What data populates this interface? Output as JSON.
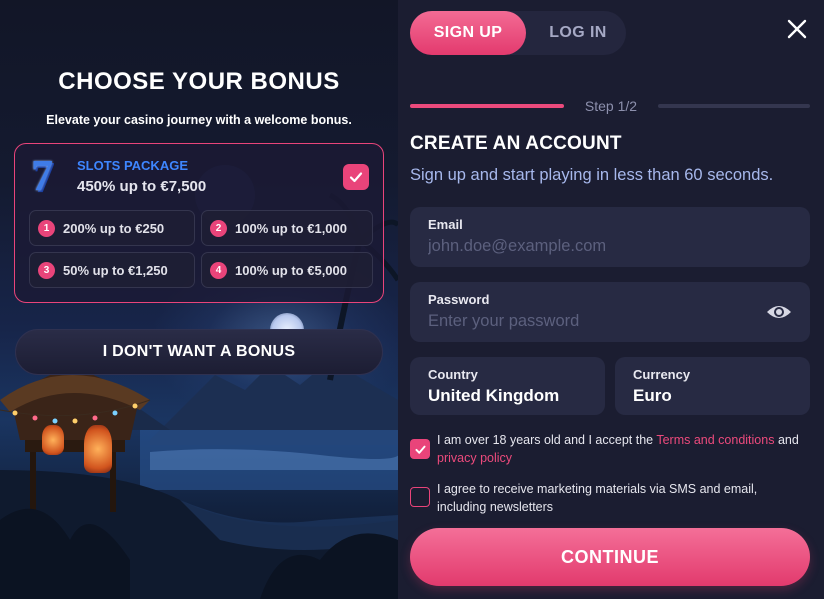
{
  "bonus": {
    "title": "CHOOSE YOUR BONUS",
    "subtitle": "Elevate your casino journey with a welcome bonus.",
    "package": {
      "icon": "lucky-seven-icon",
      "name": "SLOTS PACKAGE",
      "amount": "450% up to €7,500",
      "selected": true
    },
    "tiers": [
      {
        "num": "1",
        "label": "200% up to €250"
      },
      {
        "num": "2",
        "label": "100% up to €1,000"
      },
      {
        "num": "3",
        "label": "50% up to €1,250"
      },
      {
        "num": "4",
        "label": "100% up to €5,000"
      }
    ],
    "no_bonus_label": "I DON'T WANT A BONUS"
  },
  "auth": {
    "tabs": [
      {
        "label": "SIGN UP",
        "active": true
      },
      {
        "label": "LOG IN",
        "active": false
      }
    ],
    "step_label": "Step 1/2",
    "step_progress": 0.5,
    "heading": "CREATE AN ACCOUNT",
    "lead": "Sign up and start playing in less than 60 seconds.",
    "email": {
      "label": "Email",
      "value": "",
      "placeholder": "john.doe@example.com"
    },
    "password": {
      "label": "Password",
      "value": "",
      "placeholder": "Enter your password"
    },
    "country": {
      "label": "Country",
      "value": "United Kingdom"
    },
    "currency": {
      "label": "Currency",
      "value": "Euro"
    },
    "consent_age": {
      "checked": true,
      "text_before": "I am over 18 years old and I accept the ",
      "link1": "Terms and conditions",
      "text_mid": " and ",
      "link2": "privacy policy"
    },
    "consent_marketing": {
      "checked": false,
      "text": "I agree to receive marketing materials via SMS and email, including newsletters"
    },
    "continue_label": "CONTINUE"
  },
  "colors": {
    "accent": "#e9447a",
    "background": "#1b1d31",
    "field": "#272a43",
    "package_name": "#3e86ff",
    "lead_text": "#a7b8ec"
  }
}
